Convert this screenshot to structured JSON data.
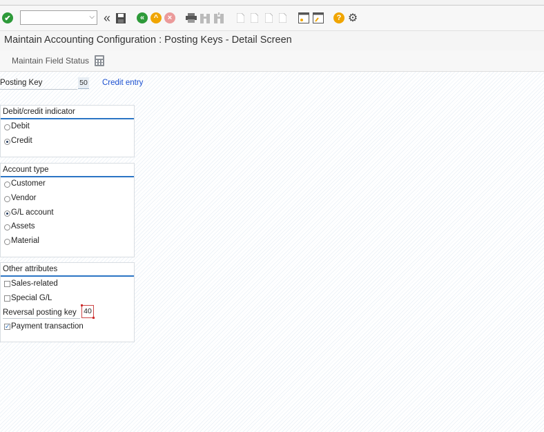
{
  "toolbar": {
    "command_field_value": "",
    "icons": [
      "enter-icon",
      "back-arrows-icon",
      "save-icon",
      "back-icon",
      "exit-icon",
      "cancel-icon",
      "print-icon",
      "find-icon",
      "find-next-icon",
      "first-page-icon",
      "previous-page-icon",
      "next-page-icon",
      "last-page-icon",
      "new-session-icon",
      "shortcut-icon",
      "help-icon",
      "settings-icon"
    ]
  },
  "title": "Maintain Accounting Configuration : Posting Keys - Detail Screen",
  "app_toolbar": {
    "maintain_field_status": "Maintain Field Status"
  },
  "posting_key": {
    "label": "Posting Key",
    "value": "50",
    "description": "Credit entry"
  },
  "debit_credit": {
    "header": "Debit/credit indicator",
    "options": [
      {
        "label": "Debit",
        "selected": false
      },
      {
        "label": "Credit",
        "selected": true
      }
    ]
  },
  "account_type": {
    "header": "Account type",
    "options": [
      {
        "label": "Customer",
        "selected": false
      },
      {
        "label": "Vendor",
        "selected": false
      },
      {
        "label": "G/L account",
        "selected": true
      },
      {
        "label": "Assets",
        "selected": false
      },
      {
        "label": "Material",
        "selected": false
      }
    ]
  },
  "other_attributes": {
    "header": "Other attributes",
    "sales_related": {
      "label": "Sales-related",
      "checked": false
    },
    "special_gl": {
      "label": "Special G/L",
      "checked": false
    },
    "reversal_posting_key": {
      "label": "Reversal posting key",
      "value": "40"
    },
    "payment_transaction": {
      "label": "Payment transaction",
      "checked": true
    }
  },
  "colors": {
    "accent": "#2a74c4",
    "link": "#1a4fd0",
    "green": "#2e9a3a",
    "orange": "#f0a500",
    "red": "#e05050"
  }
}
